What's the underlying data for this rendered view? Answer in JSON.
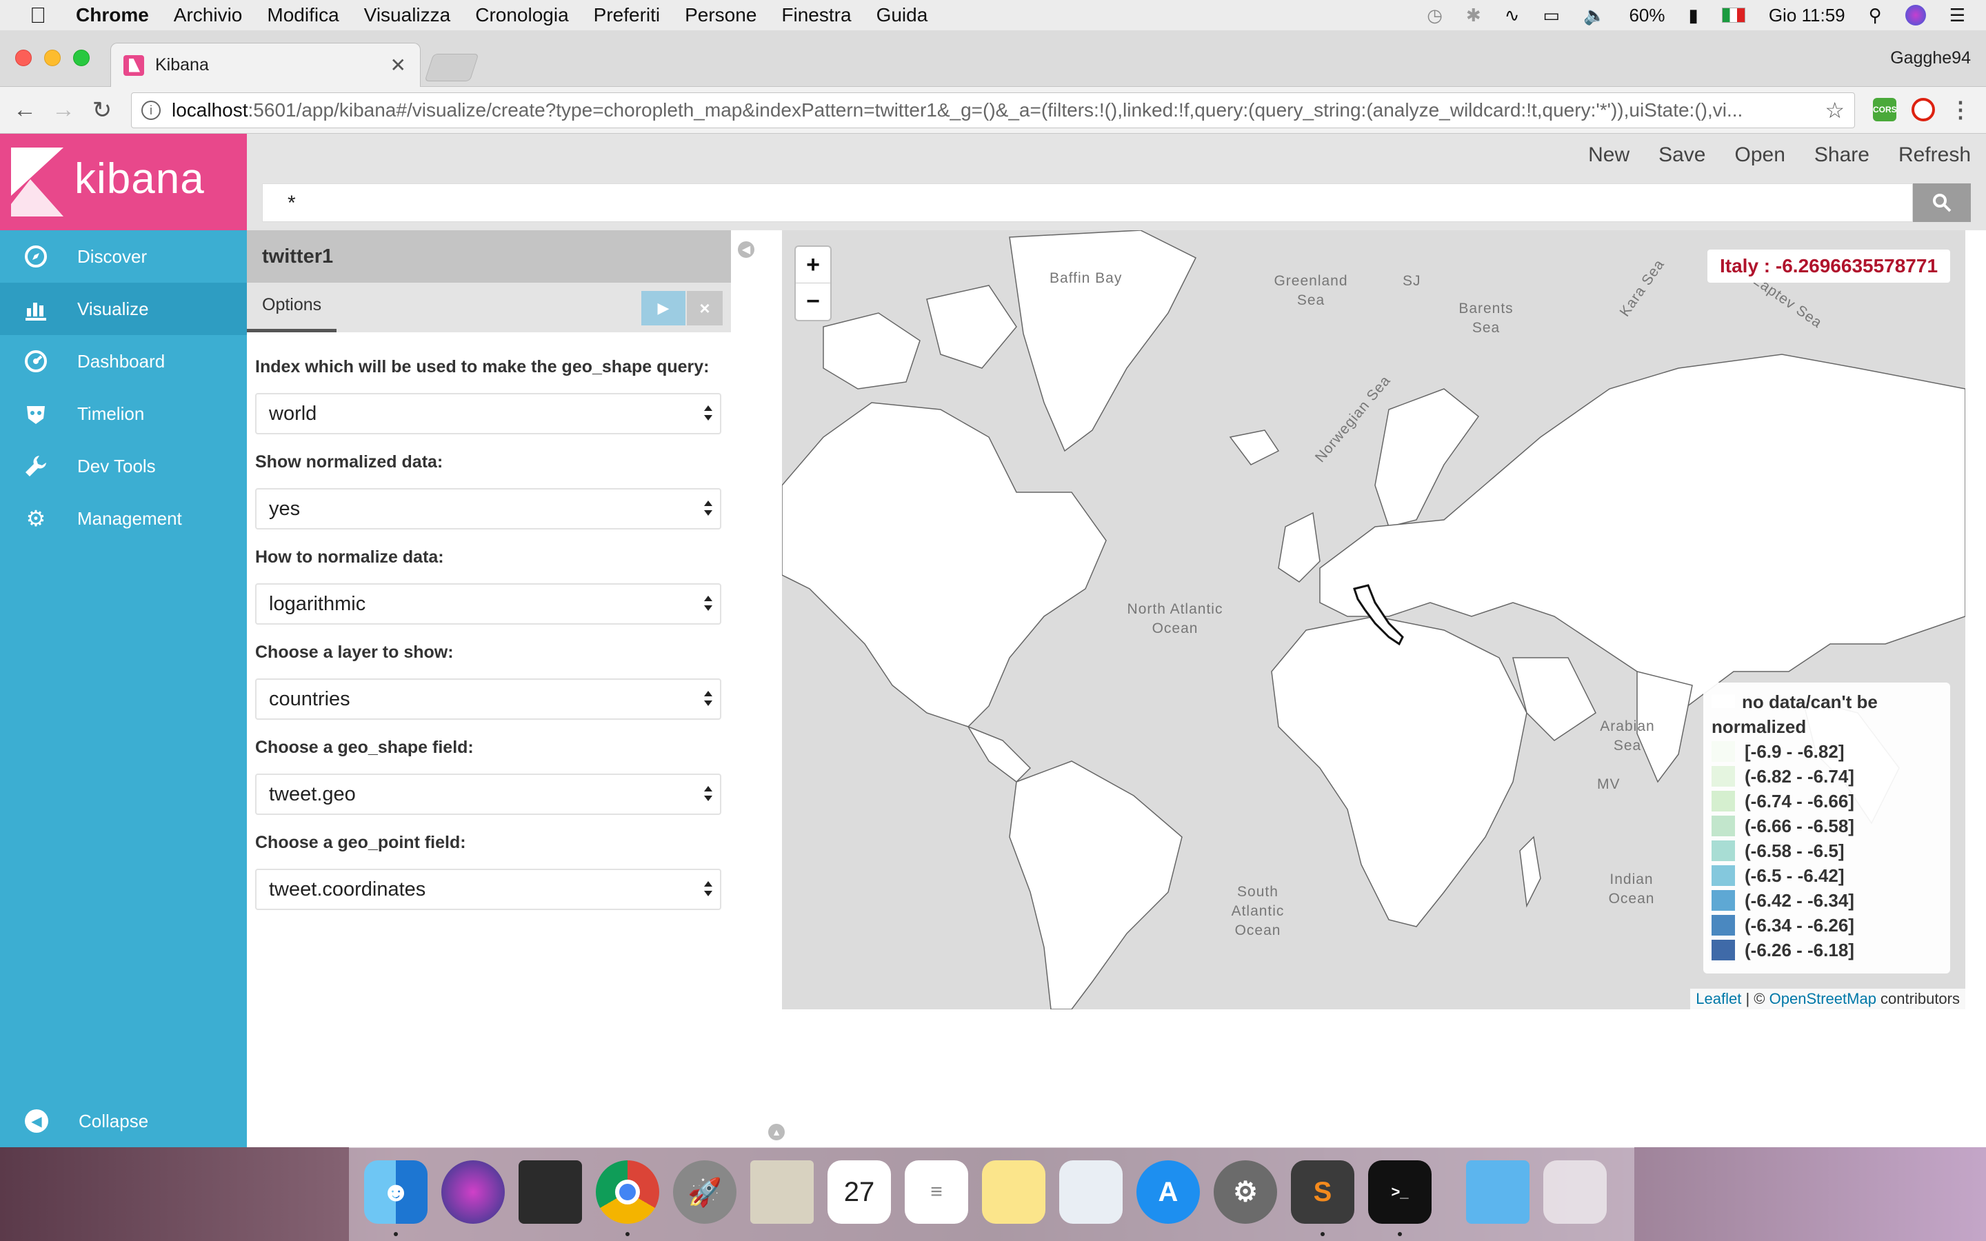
{
  "menubar": {
    "app": "Chrome",
    "items": [
      "Archivio",
      "Modifica",
      "Visualizza",
      "Cronologia",
      "Preferiti",
      "Persone",
      "Finestra",
      "Guida"
    ],
    "battery": "60%",
    "clock": "Gio 11:59"
  },
  "browser": {
    "tab_title": "Kibana",
    "profile": "Gagghe94",
    "url_host": "localhost",
    "url_path": ":5601/app/kibana#/visualize/create?type=choropleth_map&indexPattern=twitter1&_g=()&_a=(filters:!(),linked:!f,query:(query_string:(analyze_wildcard:!t,query:'*')),uiState:(),vi..."
  },
  "kibana": {
    "logo": "kibana",
    "nav": [
      {
        "label": "Discover",
        "icon": "compass-icon"
      },
      {
        "label": "Visualize",
        "icon": "bar-chart-icon"
      },
      {
        "label": "Dashboard",
        "icon": "dashboard-icon"
      },
      {
        "label": "Timelion",
        "icon": "timelion-icon"
      },
      {
        "label": "Dev Tools",
        "icon": "wrench-icon"
      },
      {
        "label": "Management",
        "icon": "gear-icon"
      }
    ],
    "collapse": "Collapse",
    "top_links": [
      "New",
      "Save",
      "Open",
      "Share",
      "Refresh"
    ],
    "query": "*"
  },
  "editor": {
    "index_pattern": "twitter1",
    "tab": "Options",
    "fields": [
      {
        "label": "Index which will be used to make the geo_shape query:",
        "value": "world"
      },
      {
        "label": "Show normalized data:",
        "value": "yes"
      },
      {
        "label": "How to normalize data:",
        "value": "logarithmic"
      },
      {
        "label": "Choose a layer to show:",
        "value": "countries"
      },
      {
        "label": "Choose a geo_shape field:",
        "value": "tweet.geo"
      },
      {
        "label": "Choose a geo_point field:",
        "value": "tweet.coordinates"
      }
    ]
  },
  "map": {
    "tooltip": "Italy : -6.2696635578771",
    "legend_title": "no data/can't be normalized",
    "legend": [
      {
        "label": "[-6.9 - -6.82]",
        "color": "#f7fcf5"
      },
      {
        "label": "(-6.82 - -6.74]",
        "color": "#e5f5e0"
      },
      {
        "label": "(-6.74 - -6.66]",
        "color": "#d5efcf"
      },
      {
        "label": "(-6.66 - -6.58]",
        "color": "#c2e6cc"
      },
      {
        "label": "(-6.58 - -6.5]",
        "color": "#a8ddd4"
      },
      {
        "label": "(-6.5 - -6.42]",
        "color": "#84c8dd"
      },
      {
        "label": "(-6.42 - -6.34]",
        "color": "#5ea8d4"
      },
      {
        "label": "(-6.34 - -6.26]",
        "color": "#4a88c0"
      },
      {
        "label": "(-6.26 - -6.18]",
        "color": "#3f6aa8"
      }
    ],
    "labels": {
      "greenland_sea": "Greenland Sea",
      "barents_sea": "Barents Sea",
      "kara_sea": "Kara Sea",
      "laptev_sea": "Laptev Sea",
      "baffin_bay": "Baffin Bay",
      "norwegian_sea": "Norwegian Sea",
      "north_atlantic": "North Atlantic Ocean",
      "south_atlantic": "South Atlantic Ocean",
      "indian_ocean": "Indian Ocean",
      "arabian_sea": "Arabian Sea",
      "mv": "MV",
      "sj": "SJ"
    },
    "attribution_leaflet": "Leaflet",
    "attribution_sep": " | © ",
    "attribution_osm": "OpenStreetMap",
    "attribution_tail": " contributors"
  }
}
